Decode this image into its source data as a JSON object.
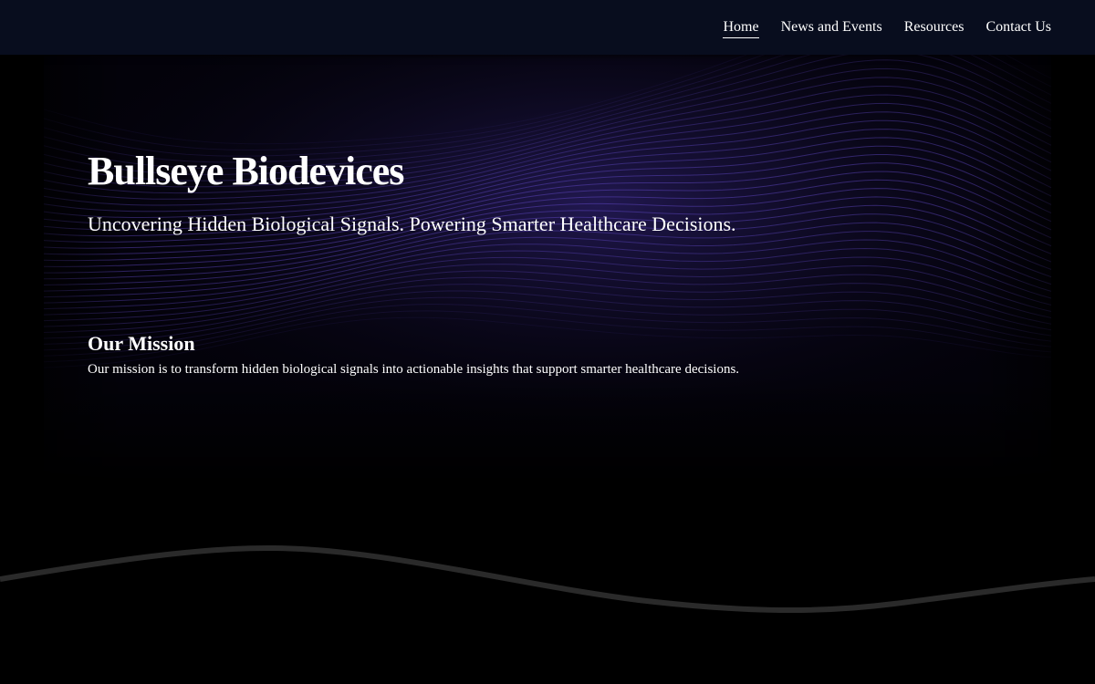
{
  "nav": {
    "items": [
      {
        "label": "Home",
        "active": true
      },
      {
        "label": "News and Events",
        "active": false
      },
      {
        "label": "Resources",
        "active": false
      },
      {
        "label": "Contact Us",
        "active": false
      }
    ]
  },
  "hero": {
    "title": "Bullseye Biodevices",
    "subtitle": "Uncovering Hidden Biological Signals. Powering Smarter Healthcare Decisions."
  },
  "mission": {
    "heading": "Our Mission",
    "text": "Our mission is to transform hidden biological signals into actionable insights that support smarter healthcare decisions."
  },
  "colors": {
    "header_bg": "#080d1e",
    "accent_purple": "#6a4fd8",
    "background": "#000000"
  }
}
